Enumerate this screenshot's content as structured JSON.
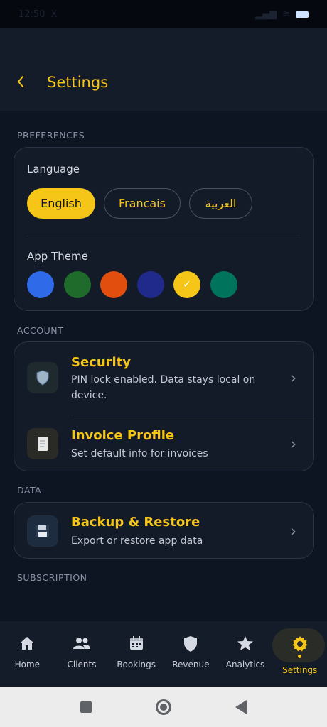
{
  "status_bar": {
    "time": "12:50",
    "x_icon": "X"
  },
  "header": {
    "title": "Settings"
  },
  "preferences": {
    "section_label": "PREFERENCES",
    "language_label": "Language",
    "languages": [
      "English",
      "Francais",
      "العربية"
    ],
    "selected_language": "English",
    "theme_label": "App Theme",
    "themes": [
      "#2f6be8",
      "#1f6b2b",
      "#e24e0d",
      "#1f2a8a",
      "#f5c518",
      "#00735d"
    ],
    "selected_theme": "#f5c518"
  },
  "account": {
    "section_label": "ACCOUNT",
    "items": [
      {
        "title": "Security",
        "subtitle": "PIN lock enabled. Data stays local on device.",
        "icon": "shield-icon"
      },
      {
        "title": "Invoice Profile",
        "subtitle": "Set default info for invoices",
        "icon": "receipt-icon"
      }
    ]
  },
  "data": {
    "section_label": "DATA",
    "items": [
      {
        "title": "Backup & Restore",
        "subtitle": "Export or restore app data",
        "icon": "floppy-disk-icon"
      }
    ]
  },
  "subscription": {
    "section_label": "SUBSCRIPTION"
  },
  "bottom_nav": [
    {
      "label": "Home",
      "icon": "home-icon"
    },
    {
      "label": "Clients",
      "icon": "people-icon"
    },
    {
      "label": "Bookings",
      "icon": "calendar-icon"
    },
    {
      "label": "Revenue",
      "icon": "shield-icon"
    },
    {
      "label": "Analytics",
      "icon": "star-icon"
    },
    {
      "label": "Settings",
      "icon": "gear-icon",
      "active": true
    }
  ]
}
